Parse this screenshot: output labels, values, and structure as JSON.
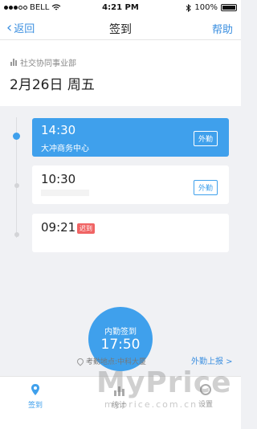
{
  "status_bar": {
    "carrier": "BELL",
    "time": "4:21 PM",
    "battery": "100%"
  },
  "nav": {
    "back_label": "返回",
    "title": "签到",
    "help_label": "帮助"
  },
  "header": {
    "department": "社交协同事业部",
    "date": "2月26日 周五"
  },
  "records": [
    {
      "time": "14:30",
      "place": "大冲商务中心",
      "badge": "外勤"
    },
    {
      "time": "10:30",
      "badge": "外勤"
    },
    {
      "time": "09:21",
      "tag": "迟到"
    }
  ],
  "checkin": {
    "label": "内勤签到",
    "time": "17:50"
  },
  "location": {
    "text": "考勤地点:中科大厦",
    "report_label": "外勤上报 >"
  },
  "tabs": [
    {
      "label": "签到"
    },
    {
      "label": "统计"
    },
    {
      "label": "设置"
    }
  ],
  "watermark": {
    "brand": "MyPrice",
    "domain": "myprice.com.cn"
  },
  "colors": {
    "accent": "#3fa0ec",
    "late": "#f06464",
    "link": "#3b8fe0"
  }
}
